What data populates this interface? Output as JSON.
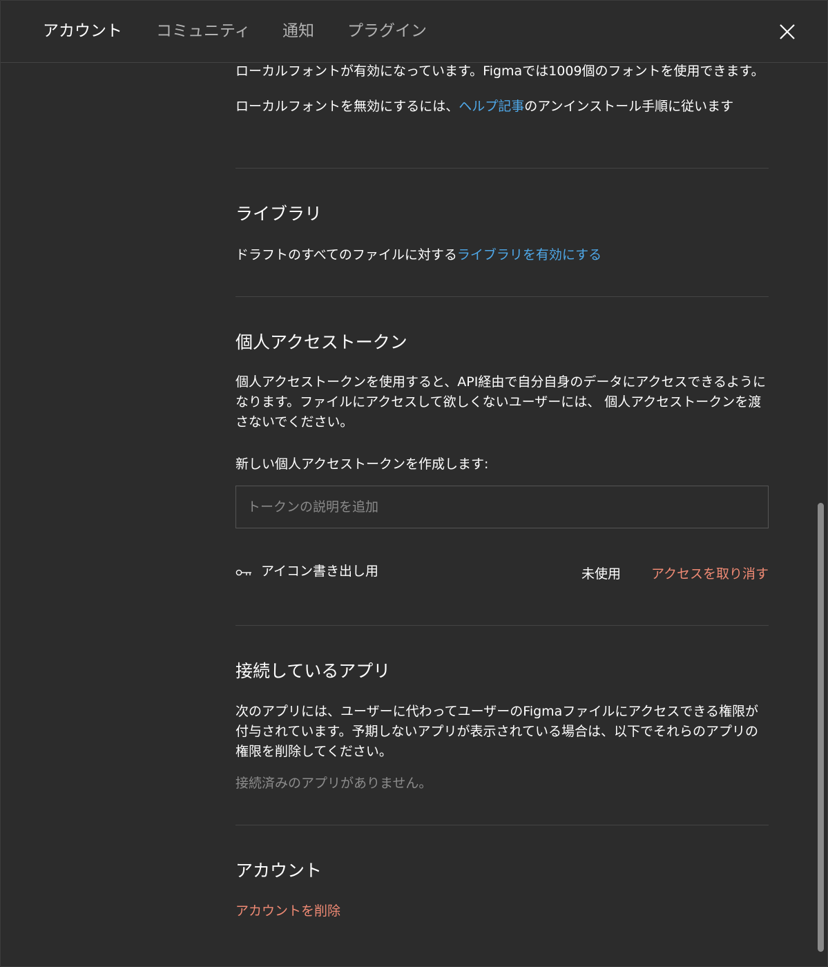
{
  "tabs": [
    {
      "label": "アカウント",
      "active": true
    },
    {
      "label": "コミュニティ",
      "active": false
    },
    {
      "label": "通知",
      "active": false
    },
    {
      "label": "プラグイン",
      "active": false
    }
  ],
  "fonts": {
    "enabled_text": "ローカルフォントが有効になっています。Figmaでは1009個のフォントを使用できます。",
    "disable_prefix": "ローカルフォントを無効にするには、",
    "help_link": "ヘルプ記事",
    "disable_suffix": "のアンインストール手順に従います"
  },
  "library": {
    "title": "ライブラリ",
    "text_prefix": "ドラフトのすべてのファイルに対する",
    "enable_link": "ライブラリを有効にする"
  },
  "tokens": {
    "title": "個人アクセストークン",
    "description": "個人アクセストークンを使用すると、API経由で自分自身のデータにアクセスできるようになります。ファイルにアクセスして欲しくないユーザーには、 個人アクセストークンを渡さないでください。",
    "create_label": "新しい個人アクセストークンを作成します:",
    "input_placeholder": "トークンの説明を追加",
    "items": [
      {
        "name": "アイコン書き出し用",
        "status": "未使用",
        "revoke_label": "アクセスを取り消す"
      }
    ]
  },
  "apps": {
    "title": "接続しているアプリ",
    "description": "次のアプリには、ユーザーに代わってユーザーのFigmaファイルにアクセスできる権限が付与されています。予期しないアプリが表示されている場合は、以下でそれらのアプリの権限を削除してください。",
    "empty_text": "接続済みのアプリがありません。"
  },
  "account": {
    "title": "アカウント",
    "delete_label": "アカウントを削除"
  },
  "colors": {
    "background": "#2c2c2c",
    "link": "#4fa8e8",
    "danger": "#ef8a74"
  }
}
